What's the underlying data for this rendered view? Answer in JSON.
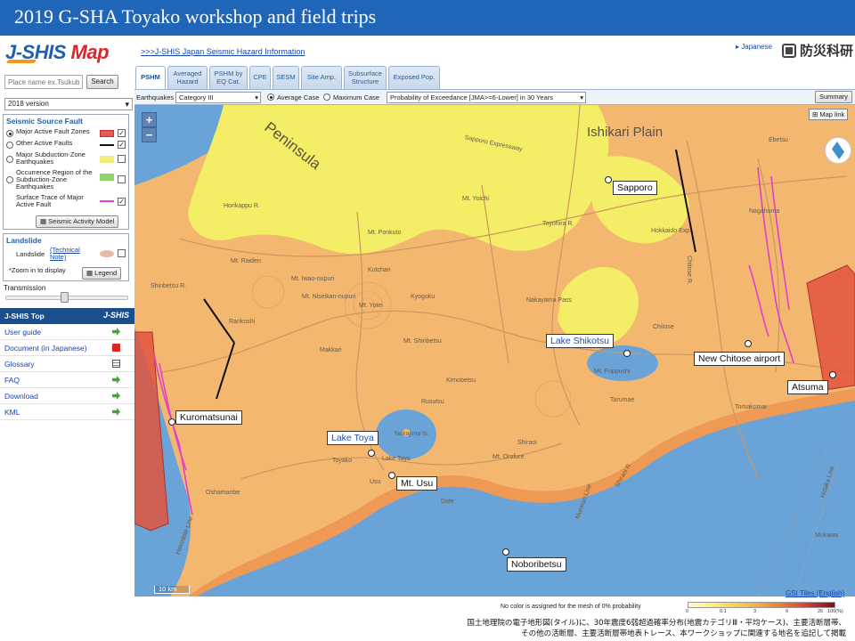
{
  "slide_title": "2019 G-SHA Toyako workshop and field trips",
  "header": {
    "logo_j": "J-SHIS",
    "logo_m": " Map",
    "jshis_link": ">>>J-SHIS Japan Seismic Hazard Information",
    "language_link": "▸ Japanese",
    "nied_label": "防災科研"
  },
  "sidebar": {
    "search_placeholder": "Place name ex.Tsukuba",
    "search_button": "Search",
    "version": "2018 version",
    "seismic_source": {
      "title": "Seismic Source Fault",
      "items": [
        {
          "label": "Major Active Fault Zones",
          "color": "#e8595a",
          "checked": "✓"
        },
        {
          "label": "Other Active Faults",
          "color": "#111111",
          "checked": "✓"
        },
        {
          "label": "Major Subduction-Zone Earthquakes",
          "color": "#f1ed7c",
          "checked": ""
        },
        {
          "label": "Occurrence Region of the Subduction-Zone Earthquakes",
          "color": "#8fd46b",
          "checked": ""
        },
        {
          "label": "Surface Trace of Major Active Fault",
          "color": "#e040c8",
          "checked": "✓"
        }
      ],
      "model_button": "Seismic Activity Model"
    },
    "landslide": {
      "title": "Landslide",
      "label": "Landslide",
      "note_link": "(Technical Note)",
      "zoom_note": "*Zoom in to display",
      "legend_button": "Legend"
    },
    "transmission_label": "Transmission",
    "nav": {
      "header": "J-SHIS Top",
      "header_logo": "J-SHIS",
      "items": [
        "User guide",
        "Document (in Japanese)",
        "Glossary",
        "FAQ",
        "Download",
        "KML"
      ]
    }
  },
  "tabs": [
    {
      "label": "PSHM"
    },
    {
      "label": "Averaged Hazard"
    },
    {
      "label": "PSHM by EQ Cat."
    },
    {
      "label": "CPE"
    },
    {
      "label": "SESM"
    },
    {
      "label": "Site Amp."
    },
    {
      "label": "Subsurface Structure"
    },
    {
      "label": "Exposed Pop."
    }
  ],
  "toolbar": {
    "earthquakes_label": "Earthquakes",
    "category": "Category III",
    "average_case": "Average Case",
    "maximum_case": "Maximum Case",
    "probability": "Probability of Exceedance [JMA>=6-Lower] in 30 Years",
    "summary": "Summary"
  },
  "map": {
    "map_link": "Map link",
    "scale": "10 km",
    "regions": [
      "Ishikari Plain",
      "Peninsula"
    ],
    "places": [
      "Sapporo",
      "Lake Shikotsu",
      "New Chitose airport",
      "Atsuma",
      "Kuromatsunai",
      "Lake Toya",
      "Mt. Usu",
      "Noboribetsu"
    ],
    "labels": [
      "Mt. Raiden",
      "Mt. Iwao-nupuri",
      "Mt. Niseikan-nupuri",
      "Mt. Yotei",
      "Kutchan",
      "Kyogoku",
      "Nakayama Pass",
      "Mt. Yoichi",
      "Mt. Ponkuto",
      "Toyohira R.",
      "Shinbetsu R.",
      "Rankoshi",
      "Makkari",
      "Mt. Shiribetsu",
      "Kimobetsu",
      "Rusutsu",
      "Mt. Fuppushi",
      "Tarumae",
      "Chitose R.",
      "Chitose",
      "Nagahuma",
      "Hokkaido Exp.",
      "Sapporo Expressway",
      "Hakodate Line",
      "Muroran Line",
      "Hidaka Line",
      "Lake Toya",
      "Toyako",
      "Oshamanbe",
      "Mt. Orofure",
      "Shiraoi R.",
      "Tomakomai",
      "Ebetsu",
      "Horikappu R.",
      "Nakajima Is.",
      "Usu",
      "Date",
      "Shiraoi",
      "Mukawa"
    ]
  },
  "legend": {
    "note": "No color is assigned for the mesh of 0% probability",
    "ticks": [
      "0",
      "0.1",
      "3",
      "6",
      "26",
      "100(%)"
    ],
    "gsi_link": "GSI Tiles (English)"
  },
  "caption": {
    "line1": "国土地理院の電子地形図(タイル)に、30年震度6弱超過確率分布(地震カテゴリⅢ・平均ケース)、主要活断層帯、",
    "line2": "その他の活断層、主要活断層帯地表トレース、本ワークショップに関連する地名を追記して掲載"
  },
  "colors": {
    "title_bar": "#1f66b8",
    "hazard_orange": "#f3b770",
    "hazard_yellow": "#f3ee66",
    "sea": "#6aa3d8",
    "fault_zone": "#e2543d",
    "fault_trace": "#e040c8"
  }
}
